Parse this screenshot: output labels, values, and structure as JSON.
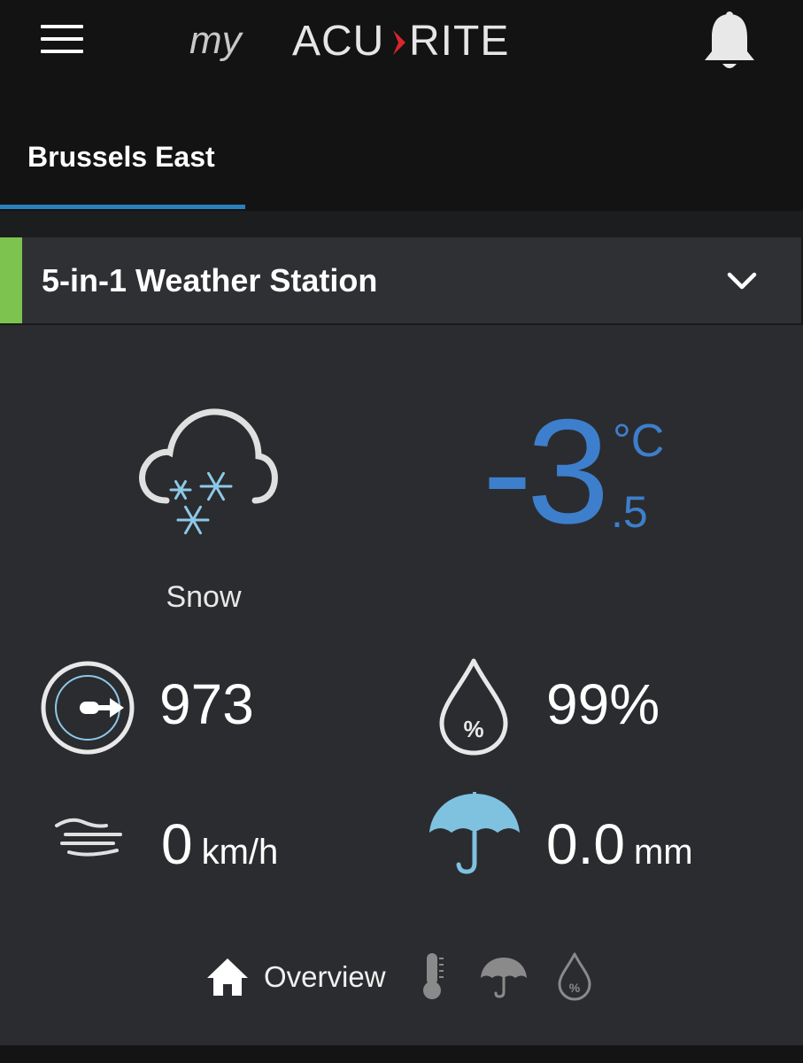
{
  "header": {
    "logo_text_prefix": "my",
    "logo_text_brand_a": "ACU",
    "logo_text_brand_b": "RITE",
    "menu_icon": "hamburger-icon",
    "bell_icon": "bell-icon"
  },
  "tabs": [
    {
      "label": "Brussels East",
      "active": true
    }
  ],
  "station": {
    "name": "5-in-1 Weather Station",
    "accent_color": "#7dc34f",
    "chevron_icon": "chevron-down-icon"
  },
  "current": {
    "condition": "Snow",
    "condition_icon": "snow-cloud-icon",
    "temperature_integer": "-3",
    "temperature_decimal": ".5",
    "temperature_unit": "°C",
    "temperature_color": "#3d7fcc"
  },
  "readings": {
    "pressure": {
      "value": "973",
      "icon": "barometer-icon"
    },
    "humidity": {
      "value": "99%",
      "icon": "humidity-drop-icon"
    },
    "wind": {
      "value": "0",
      "unit": "km/h",
      "icon": "wind-icon"
    },
    "rain": {
      "value": "0.0",
      "unit": "mm",
      "icon": "umbrella-icon"
    }
  },
  "bottom_nav": {
    "overview_label": "Overview",
    "items": [
      "home-icon",
      "thermometer-icon",
      "umbrella-icon",
      "humidity-drop-icon"
    ]
  }
}
